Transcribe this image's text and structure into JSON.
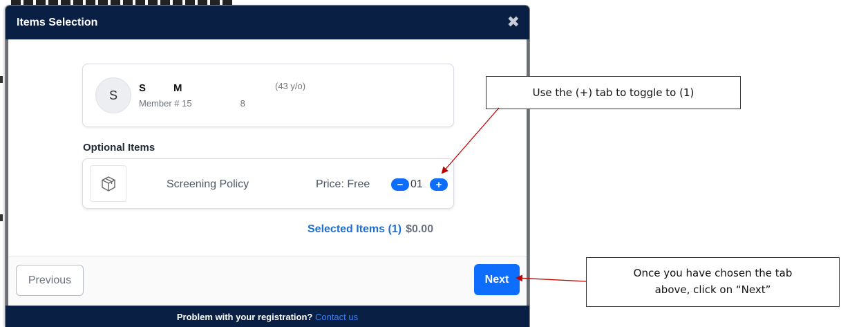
{
  "modal": {
    "title": "Items Selection",
    "close_icon": "close-icon"
  },
  "member": {
    "initial": "S",
    "name_part1": "S",
    "name_part2": "M",
    "age": "(43 y/o)",
    "number_prefix": "Member # 15",
    "number_suffix": "8"
  },
  "optional_items": {
    "title": "Optional Items",
    "items": [
      {
        "icon": "box-icon",
        "name": "Screening Policy",
        "price": "Price: Free",
        "quantity": "01",
        "minus_symbol": "−",
        "plus_symbol": "+"
      }
    ]
  },
  "summary": {
    "label": "Selected Items (1)",
    "amount": "$0.00"
  },
  "footer": {
    "previous_label": "Previous",
    "next_label": "Next",
    "help_text": "Problem with your registration?",
    "help_link": "Contact us"
  },
  "annotations": {
    "callout1": "Use the (+) tab to toggle to  (1)",
    "callout2_line1": "Once you have chosen the tab",
    "callout2_line2": "above, click on “Next”"
  },
  "colors": {
    "header": "#0a1f44",
    "primary": "#0d6efd",
    "link": "#1f6fd1",
    "arrow": "#c00000"
  }
}
